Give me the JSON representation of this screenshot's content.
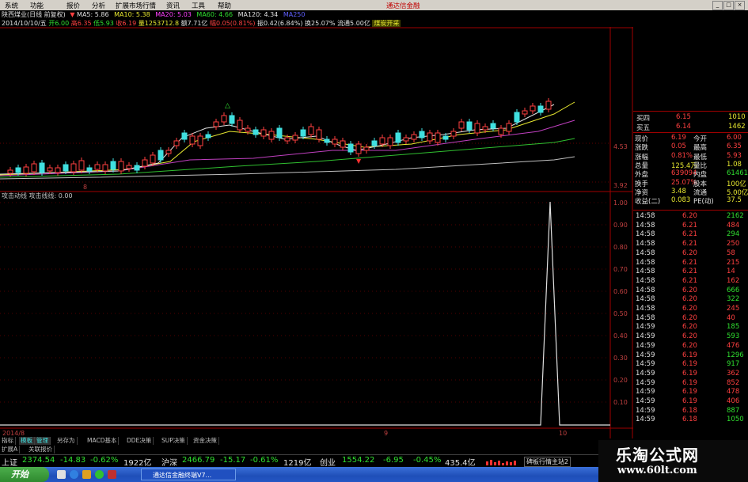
{
  "menu": {
    "items": [
      "系统",
      "功能",
      "报价",
      "分析",
      "扩展市场行情",
      "资讯",
      "工具",
      "帮助"
    ],
    "brand": "通达信金融"
  },
  "info_line1": {
    "title": "陕西煤业(日线 前复权)",
    "ma": [
      {
        "label": "MA5: 5.86",
        "color": "#e0e0e0"
      },
      {
        "label": "MA10: 5.38",
        "color": "#e8e830"
      },
      {
        "label": "MA20: 5.03",
        "color": "#ff40ff"
      },
      {
        "label": "MA60: 4.66",
        "color": "#30e030"
      },
      {
        "label": "MA120: 4.34",
        "color": "#e0e0e0"
      },
      {
        "label": "MA250",
        "color": "#6060ff"
      }
    ]
  },
  "info_line2": {
    "date": "2014/10/10/五",
    "open": "开6.00",
    "high": "高6.35",
    "low": "低5.93",
    "close": "收6.19",
    "volume": "量1253712.8",
    "amount": "额7.71亿",
    "change": "幅0.05(0.81%)",
    "amplitude": "振0.42(6.84%)",
    "turnover": "换25.07%",
    "float": "流通5.00亿",
    "tag": "煤炭开采"
  },
  "main_chart": {
    "y_labels": [
      "4.53",
      "3.92"
    ],
    "x_marks": [
      "8"
    ],
    "top_marker": "△",
    "bottom_marker": "▼",
    "left_labels": [
      "3.92"
    ]
  },
  "sub_chart": {
    "title": "攻击动线  攻击线线: 0.00",
    "y_labels": [
      "1.00",
      "0.90",
      "0.80",
      "0.70",
      "0.60",
      "0.50",
      "0.40",
      "0.30",
      "0.20",
      "0.10"
    ],
    "x_labels": [
      "2014/8",
      "9",
      "10"
    ]
  },
  "order_book": [
    {
      "label": "买四",
      "price": "6.15",
      "vol": "1010"
    },
    {
      "label": "买五",
      "price": "6.14",
      "vol": "1462"
    }
  ],
  "quote": [
    {
      "l1": "现价",
      "v1": "6.19",
      "l2": "今开",
      "v2": "6.00"
    },
    {
      "l1": "涨跌",
      "v1": "0.05",
      "l2": "最高",
      "v2": "6.35"
    },
    {
      "l1": "涨幅",
      "v1": "0.81%",
      "l2": "最低",
      "v2": "5.93"
    },
    {
      "l1": "总量",
      "v1": "125.4万",
      "l2": "量比",
      "v2": "1.08"
    },
    {
      "l1": "外盘",
      "v1": "639094",
      "l2": "内盘",
      "v2": "614618"
    },
    {
      "l1": "换手",
      "v1": "25.07%",
      "l2": "股本",
      "v2": "100亿"
    },
    {
      "l1": "净资",
      "v1": "3.48",
      "l2": "流通",
      "v2": "5.00亿"
    },
    {
      "l1": "收益(二)",
      "v1": "0.083",
      "l2": "PE(动)",
      "v2": "37.5"
    }
  ],
  "ticks": [
    {
      "t": "14:58",
      "p": "6.20",
      "v": "2162",
      "d": "g"
    },
    {
      "t": "14:58",
      "p": "6.21",
      "v": "484",
      "d": "r"
    },
    {
      "t": "14:58",
      "p": "6.21",
      "v": "294",
      "d": "g"
    },
    {
      "t": "14:58",
      "p": "6.21",
      "v": "250",
      "d": "r"
    },
    {
      "t": "14:58",
      "p": "6.20",
      "v": "58",
      "d": "r"
    },
    {
      "t": "14:58",
      "p": "6.21",
      "v": "215",
      "d": "r"
    },
    {
      "t": "14:58",
      "p": "6.21",
      "v": "14",
      "d": "r"
    },
    {
      "t": "14:58",
      "p": "6.21",
      "v": "162",
      "d": "r"
    },
    {
      "t": "14:58",
      "p": "6.20",
      "v": "666",
      "d": "g"
    },
    {
      "t": "14:58",
      "p": "6.20",
      "v": "322",
      "d": "g"
    },
    {
      "t": "14:58",
      "p": "6.20",
      "v": "245",
      "d": "r"
    },
    {
      "t": "14:58",
      "p": "6.20",
      "v": "40",
      "d": "r"
    },
    {
      "t": "14:59",
      "p": "6.20",
      "v": "185",
      "d": "g"
    },
    {
      "t": "14:59",
      "p": "6.20",
      "v": "593",
      "d": "g"
    },
    {
      "t": "14:59",
      "p": "6.20",
      "v": "476",
      "d": "r"
    },
    {
      "t": "14:59",
      "p": "6.19",
      "v": "1296",
      "d": "g"
    },
    {
      "t": "14:59",
      "p": "6.19",
      "v": "917",
      "d": "g"
    },
    {
      "t": "14:59",
      "p": "6.19",
      "v": "362",
      "d": "r"
    },
    {
      "t": "14:59",
      "p": "6.19",
      "v": "852",
      "d": "r"
    },
    {
      "t": "14:59",
      "p": "6.19",
      "v": "478",
      "d": "r"
    },
    {
      "t": "14:59",
      "p": "6.19",
      "v": "406",
      "d": "r"
    },
    {
      "t": "14:59",
      "p": "6.18",
      "v": "887",
      "d": "g"
    },
    {
      "t": "14:59",
      "p": "6.18",
      "v": "1050",
      "d": "g"
    }
  ],
  "tabs": [
    "指标",
    "模板",
    "管理",
    "另存为",
    "MACD基本",
    "DDE决策",
    "SUP决策",
    "资金决策"
  ],
  "tabs2": [
    "扩展A",
    "关联报价"
  ],
  "status": {
    "sh_label": "上证",
    "sh_val": "2374.54",
    "sh_chg": "-14.83",
    "sh_pct": "-0.62%",
    "sh_amt": "1922亿",
    "hs_label": "沪深",
    "hs_val": "2466.79",
    "hs_chg": "-15.17",
    "hs_pct": "-0.61%",
    "hs_amt": "1219亿",
    "cy_label": "创业",
    "cy_val": "1554.22",
    "cy_chg": "-6.95",
    "cy_pct": "-0.45%",
    "cy_amt": "435.4亿",
    "extra": "碑板行情主站2"
  },
  "taskbar": {
    "start": "开始",
    "item": "通达信金融终端V7..."
  },
  "watermark": {
    "cn": "乐淘公式网",
    "url": "www.60lt.com"
  }
}
